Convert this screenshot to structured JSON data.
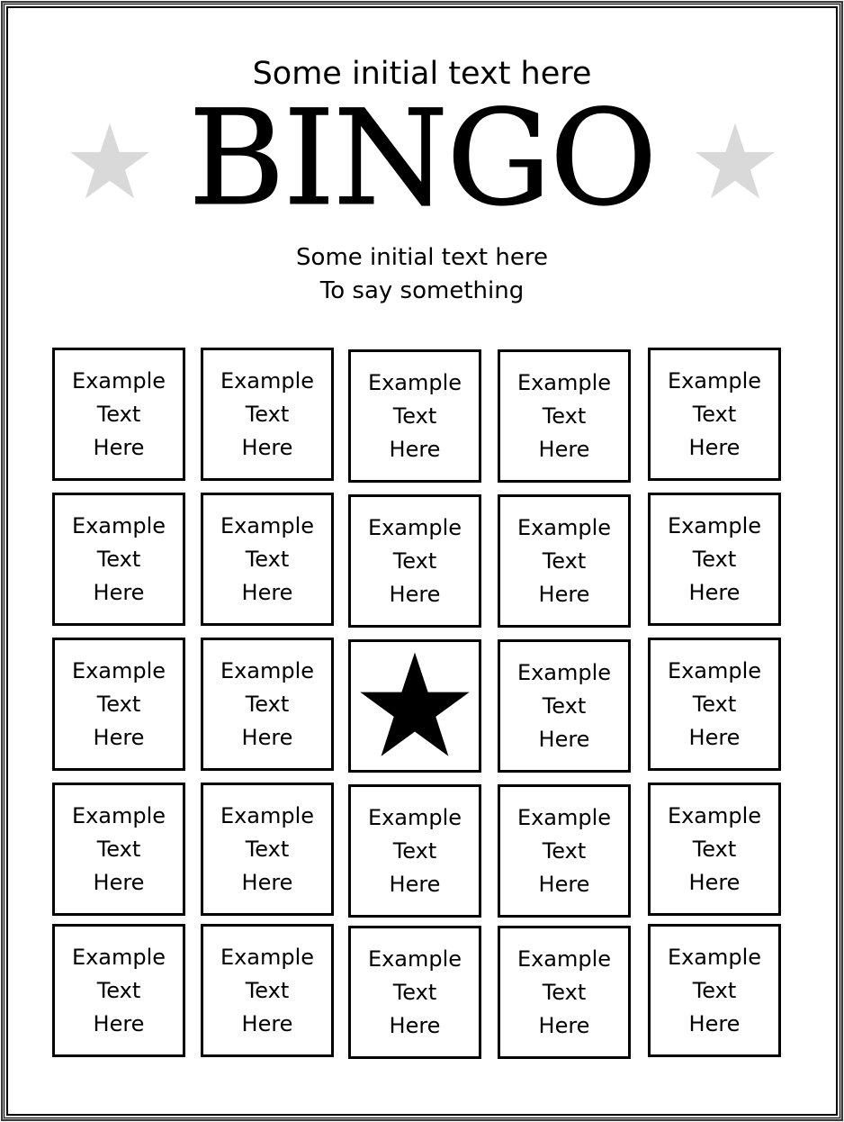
{
  "header": {
    "top_text": "Some initial text here",
    "title": "BINGO",
    "subtitle_line1": "Some initial text here",
    "subtitle_line2": "To say something",
    "decoration_icon": "star-icon",
    "decoration_color": "#d9d9d9"
  },
  "board": {
    "columns": 5,
    "rows": 5,
    "free_space_icon": "star-icon",
    "free_space_color": "#000000",
    "cells": [
      [
        "Example\nText\nHere",
        "Example\nText\nHere",
        "Example\nText\nHere",
        "Example\nText\nHere",
        "Example\nText\nHere"
      ],
      [
        "Example\nText\nHere",
        "Example\nText\nHere",
        "Example\nText\nHere",
        "Example\nText\nHere",
        "Example\nText\nHere"
      ],
      [
        "Example\nText\nHere",
        "Example\nText\nHere",
        null,
        "Example\nText\nHere",
        "Example\nText\nHere"
      ],
      [
        "Example\nText\nHere",
        "Example\nText\nHere",
        "Example\nText\nHere",
        "Example\nText\nHere",
        "Example\nText\nHere"
      ],
      [
        "Example\nText\nHere",
        "Example\nText\nHere",
        "Example\nText\nHere",
        "Example\nText\nHere",
        "Example\nText\nHere"
      ]
    ]
  }
}
